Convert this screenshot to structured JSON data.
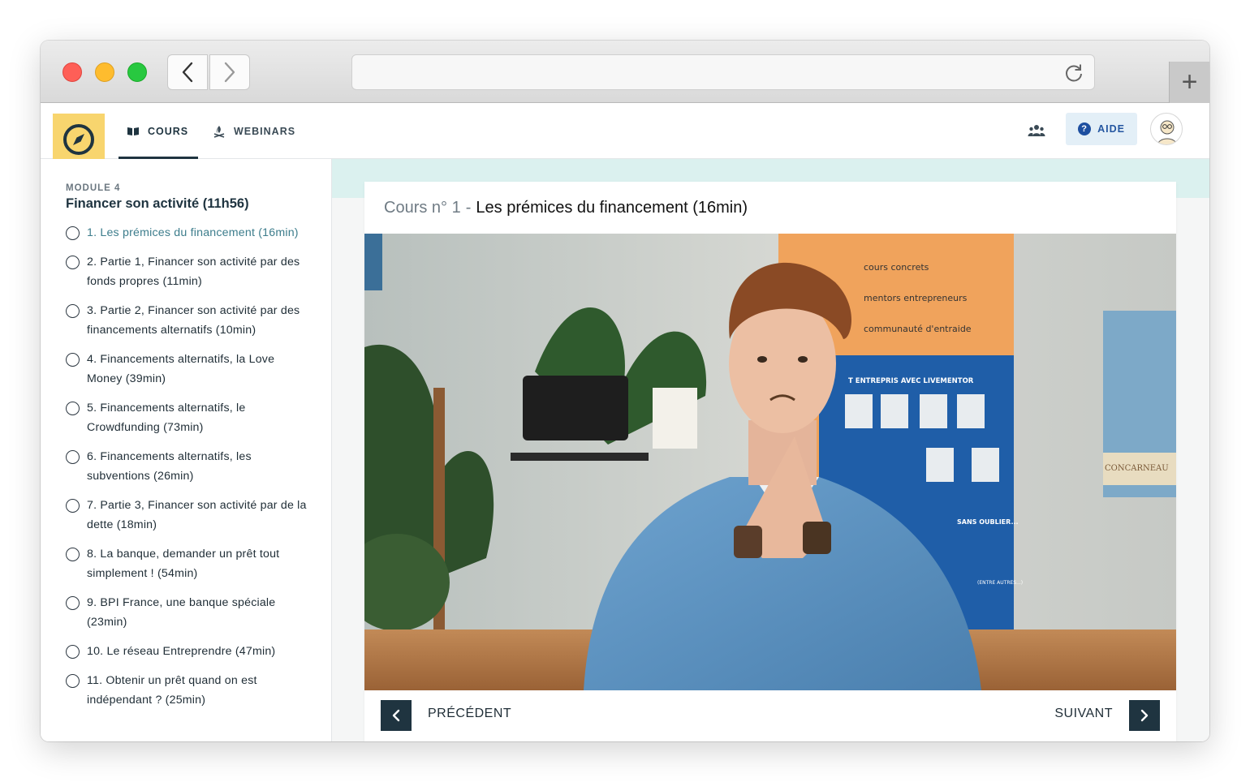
{
  "nav": {
    "cours_label": "COURS",
    "webinars_label": "WEBINARS",
    "aide_label": "AIDE",
    "aide_icon": "?"
  },
  "module": {
    "label": "MODULE 4",
    "title": "Financer son activité (11h56)",
    "lessons": [
      {
        "label": "1. Les prémices du financement (16min)",
        "active": true
      },
      {
        "label": "2. Partie 1, Financer son activité par des fonds propres (11min)",
        "active": false
      },
      {
        "label": "3. Partie 2, Financer son activité par des financements alternatifs (10min)",
        "active": false
      },
      {
        "label": "4. Financements alternatifs, la Love Money (39min)",
        "active": false
      },
      {
        "label": "5. Financements alternatifs, le Crowdfunding (73min)",
        "active": false
      },
      {
        "label": "6. Financements alternatifs, les subventions (26min)",
        "active": false
      },
      {
        "label": "7. Partie 3, Financer son activité par de la dette (18min)",
        "active": false
      },
      {
        "label": "8. La banque, demander un prêt tout simplement ! (54min)",
        "active": false
      },
      {
        "label": "9. BPI France, une banque spéciale (23min)",
        "active": false
      },
      {
        "label": "10. Le réseau Entreprendre (47min)",
        "active": false
      },
      {
        "label": "11. Obtenir un prêt quand on est indépendant ? (25min)",
        "active": false
      }
    ]
  },
  "lesson": {
    "prefix": "Cours n° 1",
    "separator": "-",
    "title": "Les prémices du financement (16min)"
  },
  "video": {
    "poster_lines": [
      "cours concrets",
      "mentors entrepreneurs",
      "communauté d'entraide",
      "T ENTREPRIS AVEC LIVEMENTOR",
      "SANS OUBLIER...",
      "(ENTRE AUTRES...)"
    ],
    "right_poster": "CONCARNEAU"
  },
  "controls": {
    "prev_label": "PRÉCÉDENT",
    "next_label": "SUIVANT"
  },
  "colors": {
    "brand_yellow": "#f8d56e",
    "navy": "#1f3440",
    "teal_band": "#dbf1ef",
    "active_lesson": "#3d7d8c",
    "aide_bg": "#e3eff7"
  }
}
